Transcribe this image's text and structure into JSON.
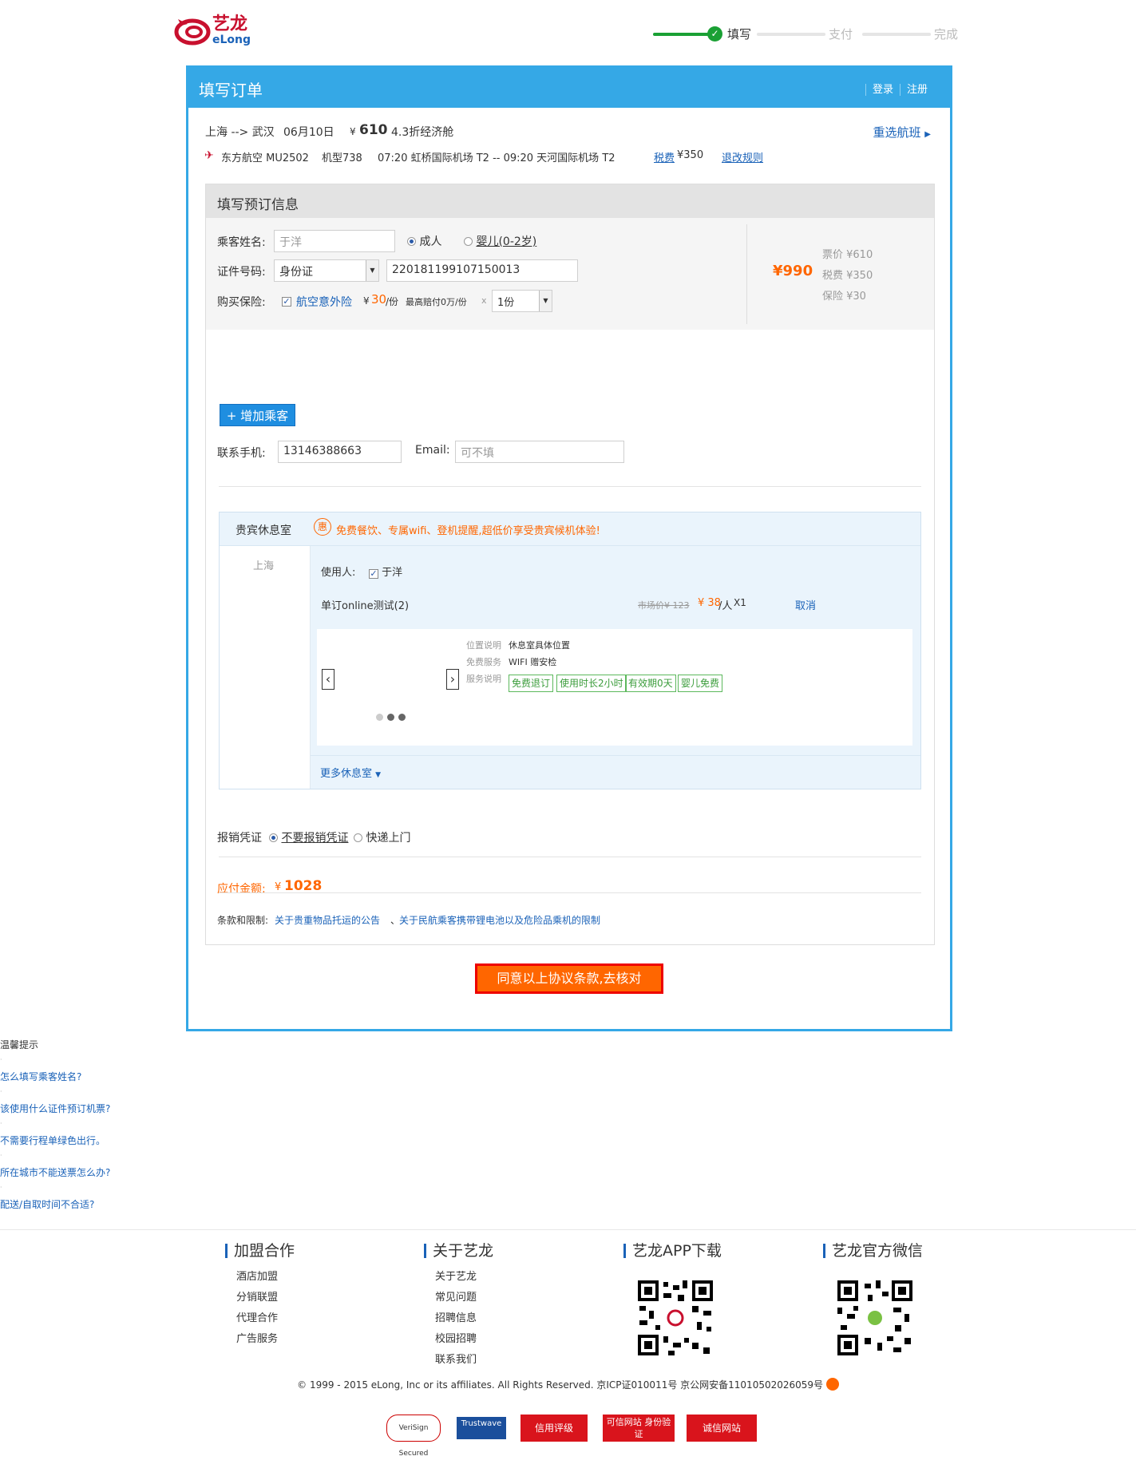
{
  "header": {
    "logo_cn": "艺龙",
    "logo_en": "eLong",
    "steps": [
      "填写",
      "支付",
      "完成"
    ]
  },
  "main": {
    "title": "填写订单",
    "login": "登录",
    "register": "注册"
  },
  "flight": {
    "route": "上海 --> 武汉",
    "date": "06月10日",
    "price_symbol": "¥",
    "price": "610",
    "discount": "4.3折经济舱",
    "reselect": "重选航班",
    "airline": "东方航空 MU2502",
    "plane": "机型738",
    "times": "07:20 虹桥国际机场  T2 -- 09:20 天河国际机场 T2",
    "tax_label": "税费",
    "tax": "¥350",
    "rules": "退改规则"
  },
  "form": {
    "section_title": "填写预订信息",
    "passenger_label": "乘客姓名:",
    "passenger_value": "于洋",
    "adult": "成人",
    "infant": "婴儿(0-2岁)",
    "id_label": "证件号码:",
    "id_type": "身份证",
    "id_number": "220181199107150013",
    "insurance_label": "购买保险:",
    "insurance_name": "航空意外险",
    "insurance_price_symbol": "¥",
    "insurance_price": "30",
    "insurance_unit": "/份",
    "insurance_max": "最高赔付0万/份",
    "times_x": "x",
    "insurance_qty": "1份",
    "total_price": "¥990",
    "ticket_price": "票价 ¥610",
    "tax_price": "税费 ¥350",
    "insurance_fee": "保险 ¥30",
    "add_passenger": "+ 增加乘客",
    "phone_label": "联系手机:",
    "phone_value": "13146388663",
    "email_label": "Email:",
    "email_placeholder": "可不填"
  },
  "lounge": {
    "title": "贵宾休息室",
    "promo": "免费餐饮、专属wifi、登机提醒,超低价享受贵宾候机体验!",
    "promo_icon": "惠",
    "city": "上海",
    "user_label": "使用人:",
    "user_name": "于洋",
    "product": "单订online测试(2)",
    "market_price": "市场价¥ 123",
    "price": "¥ 38",
    "per": "/人",
    "qty": "X1",
    "cancel": "取消",
    "location_label": "位置说明",
    "location_value": "休息室具体位置",
    "free_label": "免费服务",
    "free_value": "WIFI  赠安检",
    "service_label": "服务说明",
    "tags": [
      "免费退订",
      "使用时长2小时",
      "有效期0天",
      "婴儿免费"
    ],
    "more": "更多休息室"
  },
  "receipt": {
    "label": "报销凭证",
    "no_receipt": "不要报销凭证",
    "express": "快递上门"
  },
  "payment": {
    "label": "应付金额:",
    "symbol": "¥",
    "amount": "1028"
  },
  "terms": {
    "label": "条款和限制:",
    "link1": "关于贵重物品托运的公告",
    "sep": "、",
    "link2": "关于民航乘客携带锂电池以及危险品乘机的限制"
  },
  "submit": "同意以上协议条款,去核对",
  "tips": {
    "title": "温馨提示",
    "items": [
      "怎么填写乘客姓名?",
      "该使用什么证件预订机票?",
      "不需要行程单绿色出行。",
      "所在城市不能送票怎么办?",
      "配送/自取时间不合适?"
    ]
  },
  "footer": {
    "cols": [
      {
        "title": "加盟合作",
        "items": [
          "酒店加盟",
          "分销联盟",
          "代理合作",
          "广告服务"
        ]
      },
      {
        "title": "关于艺龙",
        "items": [
          "关于艺龙",
          "常见问题",
          "招聘信息",
          "校园招聘",
          "联系我们"
        ]
      },
      {
        "title": "艺龙APP下载",
        "items": []
      },
      {
        "title": "艺龙官方微信",
        "items": []
      }
    ],
    "copyright": "© 1999 - 2015 eLong, Inc or its affiliates. All Rights Reserved. 京ICP证010011号 京公网安备11010502026059号",
    "badges": [
      "VeriSign Secured",
      "Trustwave",
      "信用评级",
      "可信网站 身份验证",
      "诚信网站"
    ]
  },
  "colors": {
    "accent": "#35a8e6",
    "orange": "#ff6600",
    "green": "#1aa034",
    "link": "#1a62b8"
  }
}
